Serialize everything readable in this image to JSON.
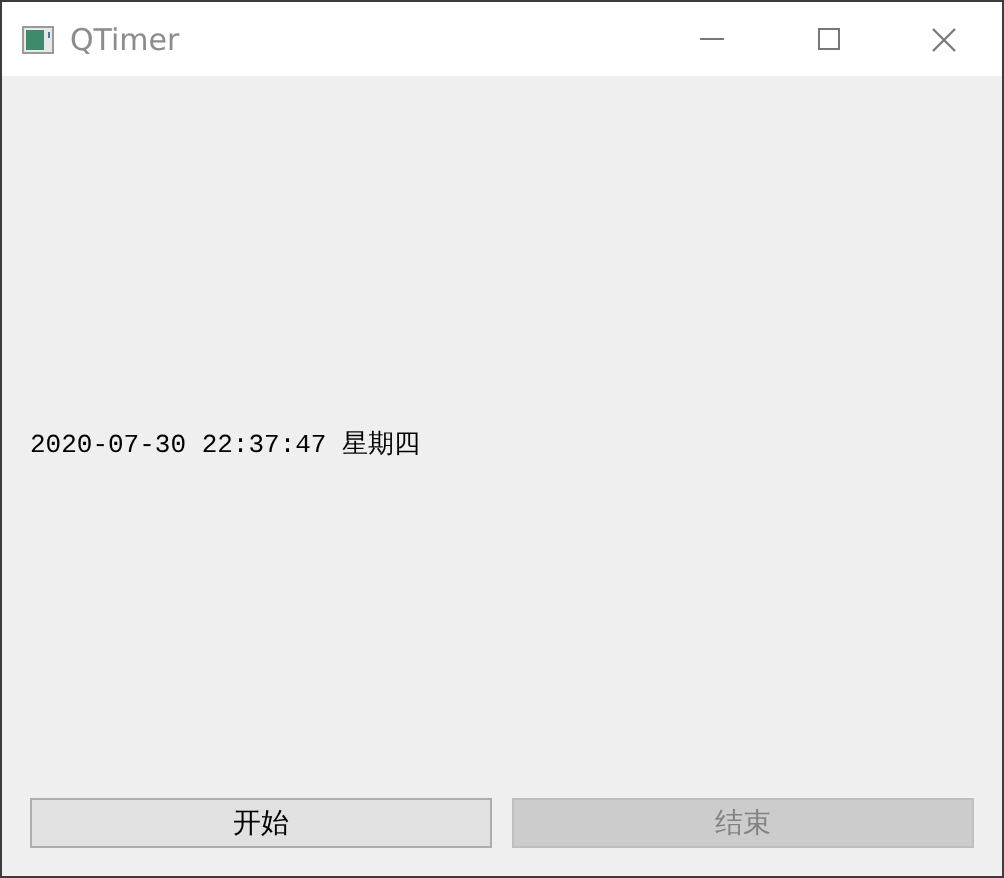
{
  "window": {
    "title": "QTimer"
  },
  "clock_text": "2020-07-30 22:37:47 星期四",
  "buttons": [
    {
      "label": "开始",
      "disabled": false
    },
    {
      "label": "结束",
      "disabled": true
    }
  ]
}
